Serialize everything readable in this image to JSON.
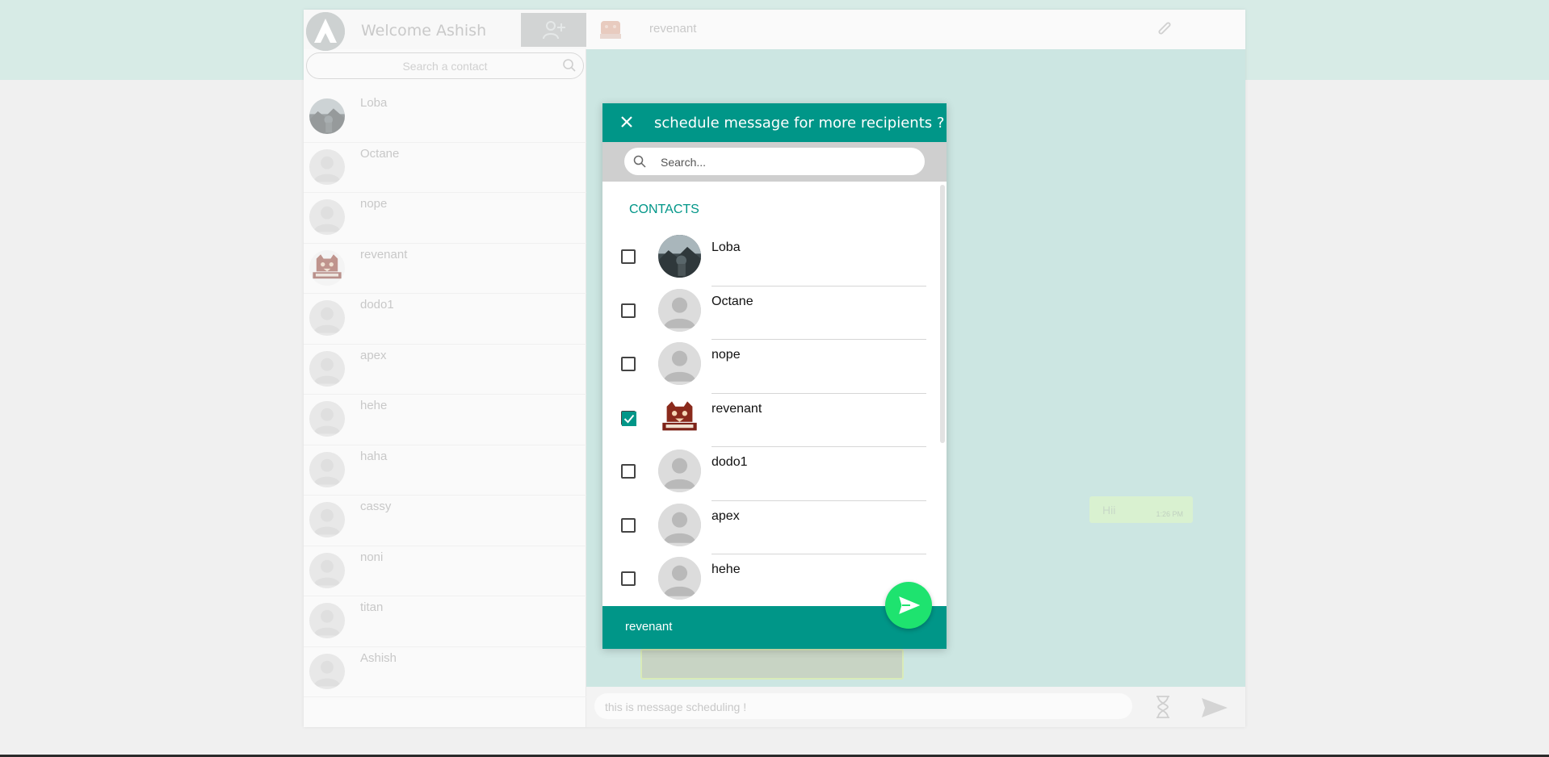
{
  "app": {
    "welcome_text": "Welcome Ashish",
    "search_placeholder": "Search a contact"
  },
  "sidebar": {
    "contacts": [
      {
        "name": "Loba",
        "avatar": "photo"
      },
      {
        "name": "Octane",
        "avatar": "default"
      },
      {
        "name": "nope",
        "avatar": "default"
      },
      {
        "name": "revenant",
        "avatar": "logo"
      },
      {
        "name": "dodo1",
        "avatar": "default"
      },
      {
        "name": "apex",
        "avatar": "default"
      },
      {
        "name": "hehe",
        "avatar": "default"
      },
      {
        "name": "haha",
        "avatar": "default"
      },
      {
        "name": "cassy",
        "avatar": "default"
      },
      {
        "name": "noni",
        "avatar": "default"
      },
      {
        "name": "titan",
        "avatar": "default"
      },
      {
        "name": "Ashish",
        "avatar": "default"
      }
    ]
  },
  "chat": {
    "contact_name": "revenant",
    "message_text": "Hii",
    "message_time": "1:26 PM",
    "compose_value": "this is message scheduling !"
  },
  "modal": {
    "title": "schedule message for more recipients ?",
    "search_placeholder": "Search...",
    "section_label": "CONTACTS",
    "contacts": [
      {
        "name": "Loba",
        "checked": false,
        "avatar": "photo"
      },
      {
        "name": "Octane",
        "checked": false,
        "avatar": "default"
      },
      {
        "name": "nope",
        "checked": false,
        "avatar": "default"
      },
      {
        "name": "revenant",
        "checked": true,
        "avatar": "logo"
      },
      {
        "name": "dodo1",
        "checked": false,
        "avatar": "default"
      },
      {
        "name": "apex",
        "checked": false,
        "avatar": "default"
      },
      {
        "name": "hehe",
        "checked": false,
        "avatar": "default"
      }
    ],
    "selected_text": "revenant"
  },
  "colors": {
    "accent": "#009688",
    "fab": "#1ee36f",
    "chat_bg": "#cce6e2",
    "top_band": "#d7ebe6"
  }
}
